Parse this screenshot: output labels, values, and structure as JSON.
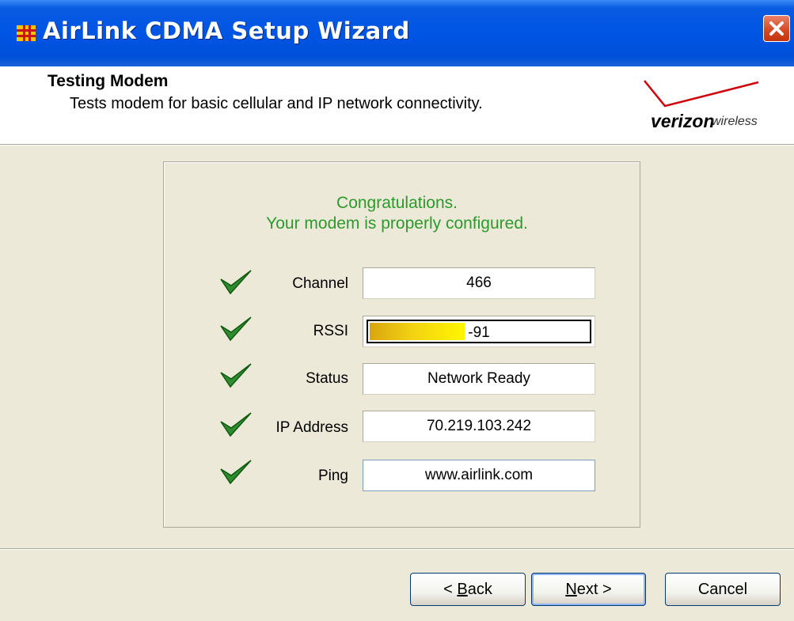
{
  "window": {
    "title": "AirLink CDMA Setup Wizard",
    "app_icon": "airlink-app-icon",
    "close_icon": "close-icon"
  },
  "header": {
    "title": "Testing Modem",
    "subtitle": "Tests modem for basic cellular and IP network connectivity.",
    "logo": {
      "brand": "verizon",
      "suffix": "wireless",
      "accent_color": "#CD040B"
    }
  },
  "message": {
    "line1": "Congratulations.",
    "line2": "Your modem is properly configured.",
    "color": "#2C9A2C"
  },
  "checks": [
    {
      "label": "Channel",
      "value": "466",
      "status": "passed",
      "icon": "green-check-icon"
    },
    {
      "label": "RSSI",
      "value": "-91",
      "status": "passed",
      "icon": "green-check-icon",
      "signal_fraction": 0.43
    },
    {
      "label": "Status",
      "value": "Network Ready",
      "status": "passed",
      "icon": "green-check-icon"
    },
    {
      "label": "IP Address",
      "value": "70.219.103.242",
      "status": "passed",
      "icon": "green-check-icon"
    },
    {
      "label": "Ping",
      "value": "www.airlink.com",
      "status": "passed",
      "icon": "green-check-icon"
    }
  ],
  "buttons": {
    "back": {
      "prefix": "< ",
      "mnemonic": "B",
      "rest": "ack"
    },
    "next": {
      "mnemonic": "N",
      "rest": "ext >"
    },
    "cancel": "Cancel"
  }
}
